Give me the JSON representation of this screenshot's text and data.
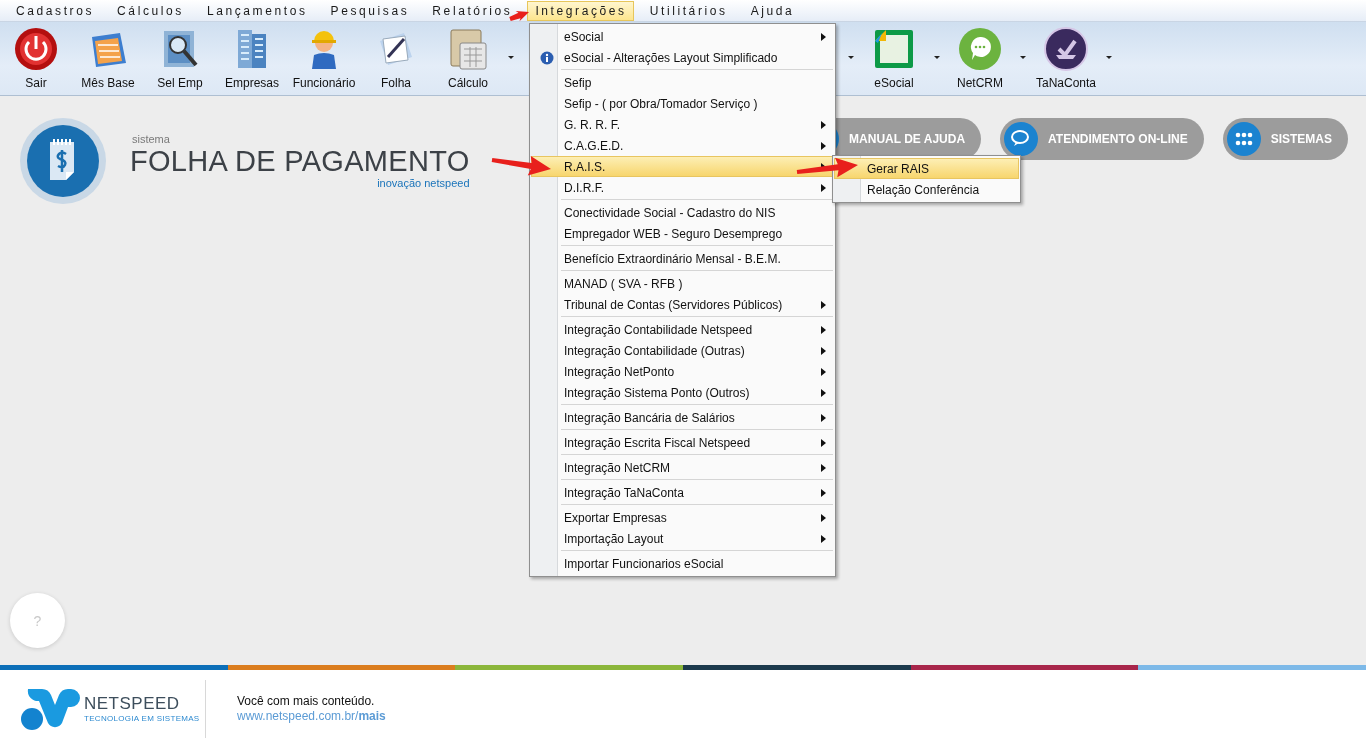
{
  "menubar": [
    {
      "label": "Cadastros",
      "selected": false
    },
    {
      "label": "Cálculos",
      "selected": false
    },
    {
      "label": "Lançamentos",
      "selected": false
    },
    {
      "label": "Pesquisas",
      "selected": false
    },
    {
      "label": "Relatórios",
      "selected": false
    },
    {
      "label": "Integrações",
      "selected": true
    },
    {
      "label": "Utilitários",
      "selected": false
    },
    {
      "label": "Ajuda",
      "selected": false
    }
  ],
  "toolbar": {
    "left": [
      {
        "label": "Sair",
        "dropdown": false
      },
      {
        "label": "Mês Base",
        "dropdown": false
      },
      {
        "label": "Sel Emp",
        "dropdown": false
      },
      {
        "label": "Empresas",
        "dropdown": false
      },
      {
        "label": "Funcionário",
        "dropdown": false
      },
      {
        "label": "Folha",
        "dropdown": false
      },
      {
        "label": "Cálculo",
        "dropdown": true
      }
    ],
    "right": [
      {
        "label": "eSocial",
        "dropdown": true
      },
      {
        "label": "NetCRM",
        "dropdown": true
      },
      {
        "label": "TaNaConta",
        "dropdown": true
      }
    ]
  },
  "menu": {
    "groups": [
      {
        "items": [
          {
            "label": "eSocial",
            "submenu": true,
            "selected": false,
            "has_icon": false
          },
          {
            "label": "eSocial - Alterações Layout Simplificado",
            "submenu": false,
            "selected": false,
            "has_icon": true
          }
        ]
      },
      {
        "items": [
          {
            "label": "Sefip",
            "submenu": false,
            "selected": false,
            "has_icon": false
          },
          {
            "label": "Sefip - ( por Obra/Tomador Serviço )",
            "submenu": false,
            "selected": false,
            "has_icon": false
          },
          {
            "label": "G. R. R. F.",
            "submenu": true,
            "selected": false,
            "has_icon": false
          },
          {
            "label": "C.A.G.E.D.",
            "submenu": true,
            "selected": false,
            "has_icon": false
          },
          {
            "label": "R.A.I.S.",
            "submenu": true,
            "selected": true,
            "has_icon": false
          },
          {
            "label": "D.I.R.F.",
            "submenu": true,
            "selected": false,
            "has_icon": false
          }
        ]
      },
      {
        "items": [
          {
            "label": "Conectividade Social - Cadastro do NIS",
            "submenu": false,
            "selected": false,
            "has_icon": false
          },
          {
            "label": "Empregador WEB - Seguro Desemprego",
            "submenu": false,
            "selected": false,
            "has_icon": false
          }
        ]
      },
      {
        "items": [
          {
            "label": "Benefício Extraordinário Mensal - B.E.M.",
            "submenu": false,
            "selected": false,
            "has_icon": false
          }
        ]
      },
      {
        "items": [
          {
            "label": "MANAD ( SVA - RFB )",
            "submenu": false,
            "selected": false,
            "has_icon": false
          },
          {
            "label": "Tribunal de Contas (Servidores Públicos)",
            "submenu": true,
            "selected": false,
            "has_icon": false
          }
        ]
      },
      {
        "items": [
          {
            "label": "Integração Contabilidade Netspeed",
            "submenu": true,
            "selected": false,
            "has_icon": false
          },
          {
            "label": "Integração Contabilidade (Outras)",
            "submenu": true,
            "selected": false,
            "has_icon": false
          },
          {
            "label": "Integração NetPonto",
            "submenu": true,
            "selected": false,
            "has_icon": false
          },
          {
            "label": "Integração Sistema Ponto (Outros)",
            "submenu": true,
            "selected": false,
            "has_icon": false
          }
        ]
      },
      {
        "items": [
          {
            "label": "Integração Bancária de Salários",
            "submenu": true,
            "selected": false,
            "has_icon": false
          }
        ]
      },
      {
        "items": [
          {
            "label": "Integração Escrita Fiscal Netspeed",
            "submenu": true,
            "selected": false,
            "has_icon": false
          }
        ]
      },
      {
        "items": [
          {
            "label": "Integração NetCRM",
            "submenu": true,
            "selected": false,
            "has_icon": false
          }
        ]
      },
      {
        "items": [
          {
            "label": "Integração TaNaConta",
            "submenu": true,
            "selected": false,
            "has_icon": false
          }
        ]
      },
      {
        "items": [
          {
            "label": "Exportar Empresas",
            "submenu": true,
            "selected": false,
            "has_icon": false
          },
          {
            "label": "Importação Layout",
            "submenu": true,
            "selected": false,
            "has_icon": false
          }
        ]
      },
      {
        "items": [
          {
            "label": "Importar Funcionarios eSocial",
            "submenu": false,
            "selected": false,
            "has_icon": false
          }
        ]
      }
    ]
  },
  "submenu": {
    "items": [
      {
        "label": "Gerar RAIS",
        "selected": true
      },
      {
        "label": "Relação Conferência",
        "selected": false
      }
    ]
  },
  "brand": {
    "prefix": "sistema",
    "title": "FOLHA DE PAGAMENTO",
    "tagline": "inovação netspeed"
  },
  "links": [
    {
      "label": "MANUAL DE AJUDA"
    },
    {
      "label": "ATENDIMENTO ON-LINE"
    },
    {
      "label": "SISTEMAS"
    }
  ],
  "help_button": {
    "label": "?"
  },
  "footer": {
    "company": "NETSPEED",
    "company_tagline": "TECNOLOGIA EM SISTEMAS",
    "message": "Você com mais conteúdo.",
    "link": "www.netspeed.com.br/**mais**"
  }
}
